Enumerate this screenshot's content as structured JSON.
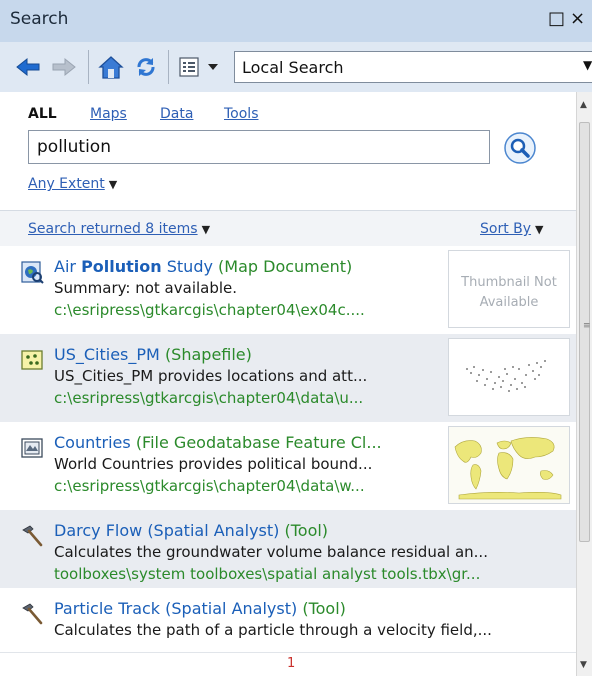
{
  "window": {
    "title": "Search",
    "maximize_glyph": "□",
    "close_glyph": "×"
  },
  "toolbar": {
    "icons": [
      "back-arrow-icon",
      "forward-arrow-icon",
      "home-icon",
      "refresh-icon",
      "options-icon",
      "dropdown-icon"
    ],
    "location": "Local Search"
  },
  "search": {
    "tabs": [
      {
        "label": "ALL",
        "active": true
      },
      {
        "label": "Maps",
        "active": false
      },
      {
        "label": "Data",
        "active": false
      },
      {
        "label": "Tools",
        "active": false
      }
    ],
    "query": "pollution",
    "extent_label": "Any Extent"
  },
  "results": {
    "summary": "Search returned 8 items",
    "sort_label": "Sort By",
    "items": [
      {
        "icon": "map-document-icon",
        "title_prefix": "Air ",
        "title_bold": "Pollution",
        "title_suffix": " Study",
        "type": "(Map Document)",
        "description": "Summary: not available.",
        "path": "c:\\esripress\\gtkarcgis\\chapter04\\ex04c....",
        "thumbnail": "text",
        "thumbnail_text": "Thumbnail Not Available"
      },
      {
        "icon": "shapefile-icon",
        "title_prefix": "US_Cities_PM",
        "title_bold": "",
        "title_suffix": "",
        "type": "(Shapefile)",
        "description": "US_Cities_PM provides locations and att...",
        "path": "c:\\esripress\\gtkarcgis\\chapter04\\data\\u...",
        "thumbnail": "points-map"
      },
      {
        "icon": "feature-class-icon",
        "title_prefix": "Countries",
        "title_bold": "",
        "title_suffix": "",
        "type": "(File Geodatabase Feature Cl...",
        "description": "World Countries provides political bound...",
        "path": "c:\\esripress\\gtkarcgis\\chapter04\\data\\w...",
        "thumbnail": "world-map"
      },
      {
        "icon": "tool-hammer-icon",
        "title_prefix": "Darcy Flow (Spatial Analyst)",
        "title_bold": "",
        "title_suffix": "",
        "type": "(Tool)",
        "description": "Calculates the groundwater volume balance residual an...",
        "path": "toolboxes\\system toolboxes\\spatial analyst tools.tbx\\gr...",
        "thumbnail": "none"
      },
      {
        "icon": "tool-hammer-icon",
        "title_prefix": "Particle Track (Spatial Analyst)",
        "title_bold": "",
        "title_suffix": "",
        "type": "(Tool)",
        "description": "Calculates the path of a particle through a velocity field,...",
        "path": "",
        "thumbnail": "none"
      }
    ],
    "page": "1"
  },
  "colors": {
    "title_bar": "#c7d8ec",
    "toolbar": "#dfe8f3",
    "link": "#2e5fb5",
    "result_title": "#1b5fb8",
    "path_green": "#2b8a2b",
    "page_number": "#c9302c"
  }
}
